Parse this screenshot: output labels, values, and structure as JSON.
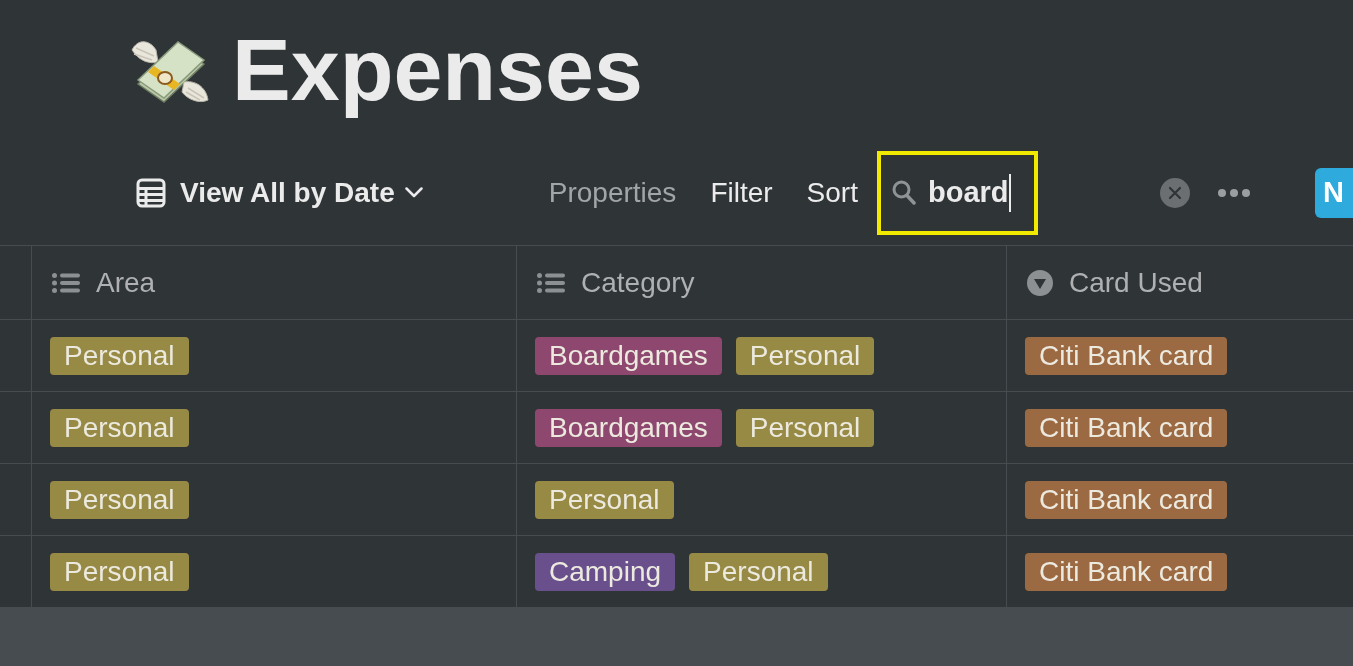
{
  "page": {
    "title": "Expenses"
  },
  "toolbar": {
    "view_label": "View All by Date",
    "actions": [
      {
        "label": "Properties",
        "active": false
      },
      {
        "label": "Filter",
        "active": true
      },
      {
        "label": "Sort",
        "active": true
      }
    ],
    "search": {
      "value": "board",
      "highlighted": true
    },
    "new_button": {
      "label": "N"
    }
  },
  "table": {
    "columns": [
      {
        "name": "Area",
        "kind": "multi_select"
      },
      {
        "name": "Category",
        "kind": "multi_select"
      },
      {
        "name": "Card Used",
        "kind": "select"
      }
    ],
    "rows": [
      {
        "cells": [
          {
            "tags": [
              {
                "label": "Personal",
                "color": "#978a44"
              }
            ]
          },
          {
            "tags": [
              {
                "label": "Boardgames",
                "color": "#8e4870"
              },
              {
                "label": "Personal",
                "color": "#978a44"
              }
            ]
          },
          {
            "tags": [
              {
                "label": "Citi Bank card",
                "color": "#9c6a42"
              }
            ]
          }
        ]
      },
      {
        "cells": [
          {
            "tags": [
              {
                "label": "Personal",
                "color": "#978a44"
              }
            ]
          },
          {
            "tags": [
              {
                "label": "Boardgames",
                "color": "#8e4870"
              },
              {
                "label": "Personal",
                "color": "#978a44"
              }
            ]
          },
          {
            "tags": [
              {
                "label": "Citi Bank card",
                "color": "#9c6a42"
              }
            ]
          }
        ]
      },
      {
        "cells": [
          {
            "tags": [
              {
                "label": "Personal",
                "color": "#978a44"
              }
            ]
          },
          {
            "tags": [
              {
                "label": "Personal",
                "color": "#978a44"
              }
            ]
          },
          {
            "tags": [
              {
                "label": "Citi Bank card",
                "color": "#9c6a42"
              }
            ]
          }
        ]
      },
      {
        "cells": [
          {
            "tags": [
              {
                "label": "Personal",
                "color": "#978a44"
              }
            ]
          },
          {
            "tags": [
              {
                "label": "Camping",
                "color": "#69508c"
              },
              {
                "label": "Personal",
                "color": "#978a44"
              }
            ]
          },
          {
            "tags": [
              {
                "label": "Citi Bank card",
                "color": "#9c6a42"
              }
            ]
          }
        ]
      }
    ]
  }
}
